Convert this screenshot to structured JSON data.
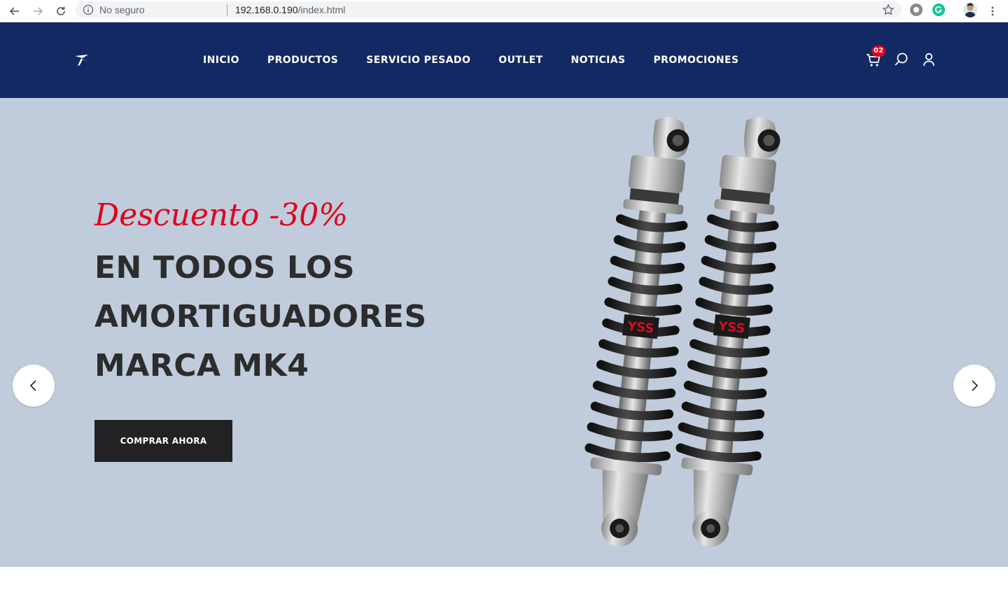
{
  "browser": {
    "security_label": "No seguro",
    "url_host": "192.168.0.190",
    "url_path": "/index.html",
    "icons": [
      "back-icon",
      "forward-icon",
      "reload-icon",
      "info-icon",
      "bookmark-star-icon",
      "extension-icon",
      "grammarly-icon",
      "profile-avatar",
      "menu-dots-icon"
    ]
  },
  "header": {
    "nav": [
      "INICIO",
      "PRODUCTOS",
      "SERVICIO PESADO",
      "OUTLET",
      "NOTICIAS",
      "PROMOCIONES"
    ],
    "cart_count": "02",
    "icons": [
      "logo",
      "cart-icon",
      "search-icon",
      "user-icon"
    ]
  },
  "hero": {
    "promo": "Descuento -30%",
    "headline": [
      "EN TODOS LOS",
      "AMORTIGUADORES",
      "MARCA MK4"
    ],
    "cta": "COMPRAR AHORA",
    "shock_brand_mark": "YSS"
  },
  "colors": {
    "header_bg": "#132963",
    "hero_bg": "#c0ccdb",
    "promo_red": "#e0001b",
    "cta_bg": "#222222"
  }
}
